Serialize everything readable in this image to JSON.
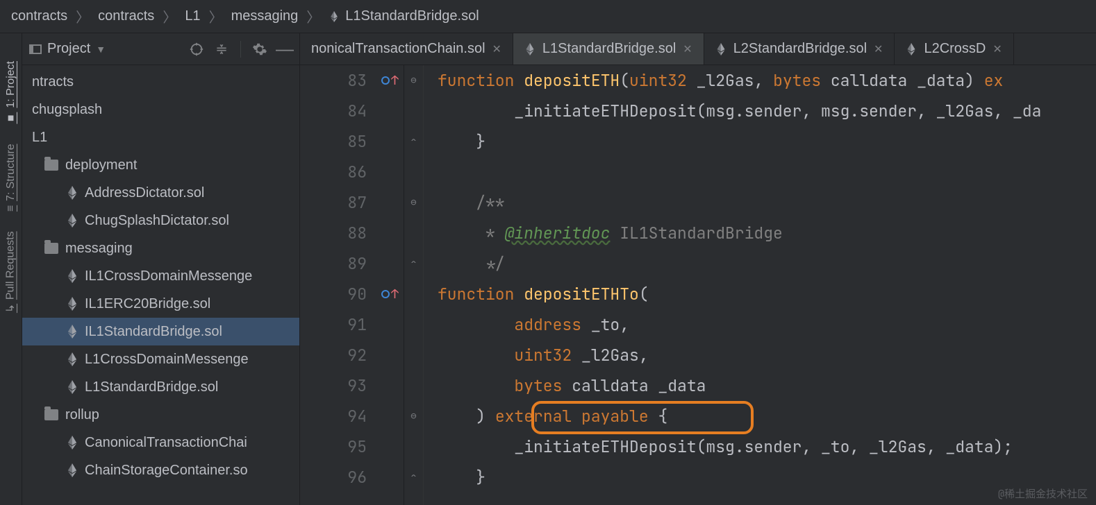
{
  "breadcrumb": [
    "contracts",
    "contracts",
    "L1",
    "messaging",
    "L1StandardBridge.sol"
  ],
  "project_toolbar": {
    "title": "Project"
  },
  "side_tools": {
    "project": "1: Project",
    "structure": "7: Structure",
    "pull_requests": "Pull Requests"
  },
  "tree": [
    {
      "label": "ntracts",
      "depth": 0,
      "icon": "none"
    },
    {
      "label": "chugsplash",
      "depth": 0,
      "icon": "none"
    },
    {
      "label": "L1",
      "depth": 0,
      "icon": "none"
    },
    {
      "label": "deployment",
      "depth": 1,
      "icon": "folder"
    },
    {
      "label": "AddressDictator.sol",
      "depth": 2,
      "icon": "eth"
    },
    {
      "label": "ChugSplashDictator.sol",
      "depth": 2,
      "icon": "eth"
    },
    {
      "label": "messaging",
      "depth": 1,
      "icon": "folder"
    },
    {
      "label": "IL1CrossDomainMessenge",
      "depth": 2,
      "icon": "eth"
    },
    {
      "label": "IL1ERC20Bridge.sol",
      "depth": 2,
      "icon": "eth"
    },
    {
      "label": "IL1StandardBridge.sol",
      "depth": 2,
      "icon": "eth",
      "selected": true
    },
    {
      "label": "L1CrossDomainMessenge",
      "depth": 2,
      "icon": "eth"
    },
    {
      "label": "L1StandardBridge.sol",
      "depth": 2,
      "icon": "eth"
    },
    {
      "label": "rollup",
      "depth": 1,
      "icon": "folder"
    },
    {
      "label": "CanonicalTransactionChai",
      "depth": 2,
      "icon": "eth"
    },
    {
      "label": "ChainStorageContainer.so",
      "depth": 2,
      "icon": "eth"
    }
  ],
  "tabs": [
    {
      "label": "nonicalTransactionChain.sol",
      "active": false,
      "icon": "none"
    },
    {
      "label": "L1StandardBridge.sol",
      "active": true,
      "icon": "eth"
    },
    {
      "label": "L2StandardBridge.sol",
      "active": false,
      "icon": "eth"
    },
    {
      "label": "L2CrossD",
      "active": false,
      "icon": "eth"
    }
  ],
  "line_numbers": [
    "83",
    "84",
    "85",
    "86",
    "87",
    "88",
    "89",
    "90",
    "91",
    "92",
    "93",
    "94",
    "95",
    "96"
  ],
  "code": {
    "l83_kw1": "function",
    "l83_fn": "depositETH",
    "l83_p": "(",
    "l83_ty1": "uint32",
    "l83_id1": " _l2Gas, ",
    "l83_ty2": "bytes",
    "l83_id2": " calldata _data) ",
    "l83_kw2": "ex",
    "l84": "        _initiateETHDeposit(msg.sender, msg.sender, _l2Gas, _da",
    "l85": "    }",
    "l86": "",
    "l87": "    /**",
    "l88_pre": "     * ",
    "l88_doc": "@inheritdoc",
    "l88_post": " IL1StandardBridge",
    "l89": "     */",
    "l90_kw": "function",
    "l90_fn": "depositETHTo",
    "l90_p": "(",
    "l91_ty": "address",
    "l91_id": " _to,",
    "l92_ty": "uint32",
    "l92_id": " _l2Gas,",
    "l93_ty": "bytes",
    "l93_id": " calldata _data",
    "l94_p": "    ) ",
    "l94_kw1": "external",
    "l94_sp": " ",
    "l94_kw2": "payable",
    "l94_br": " {",
    "l95": "        _initiateETHDeposit(msg.sender, _to, _l2Gas, _data);",
    "l96": "    }"
  },
  "watermark": "@稀土掘金技术社区"
}
